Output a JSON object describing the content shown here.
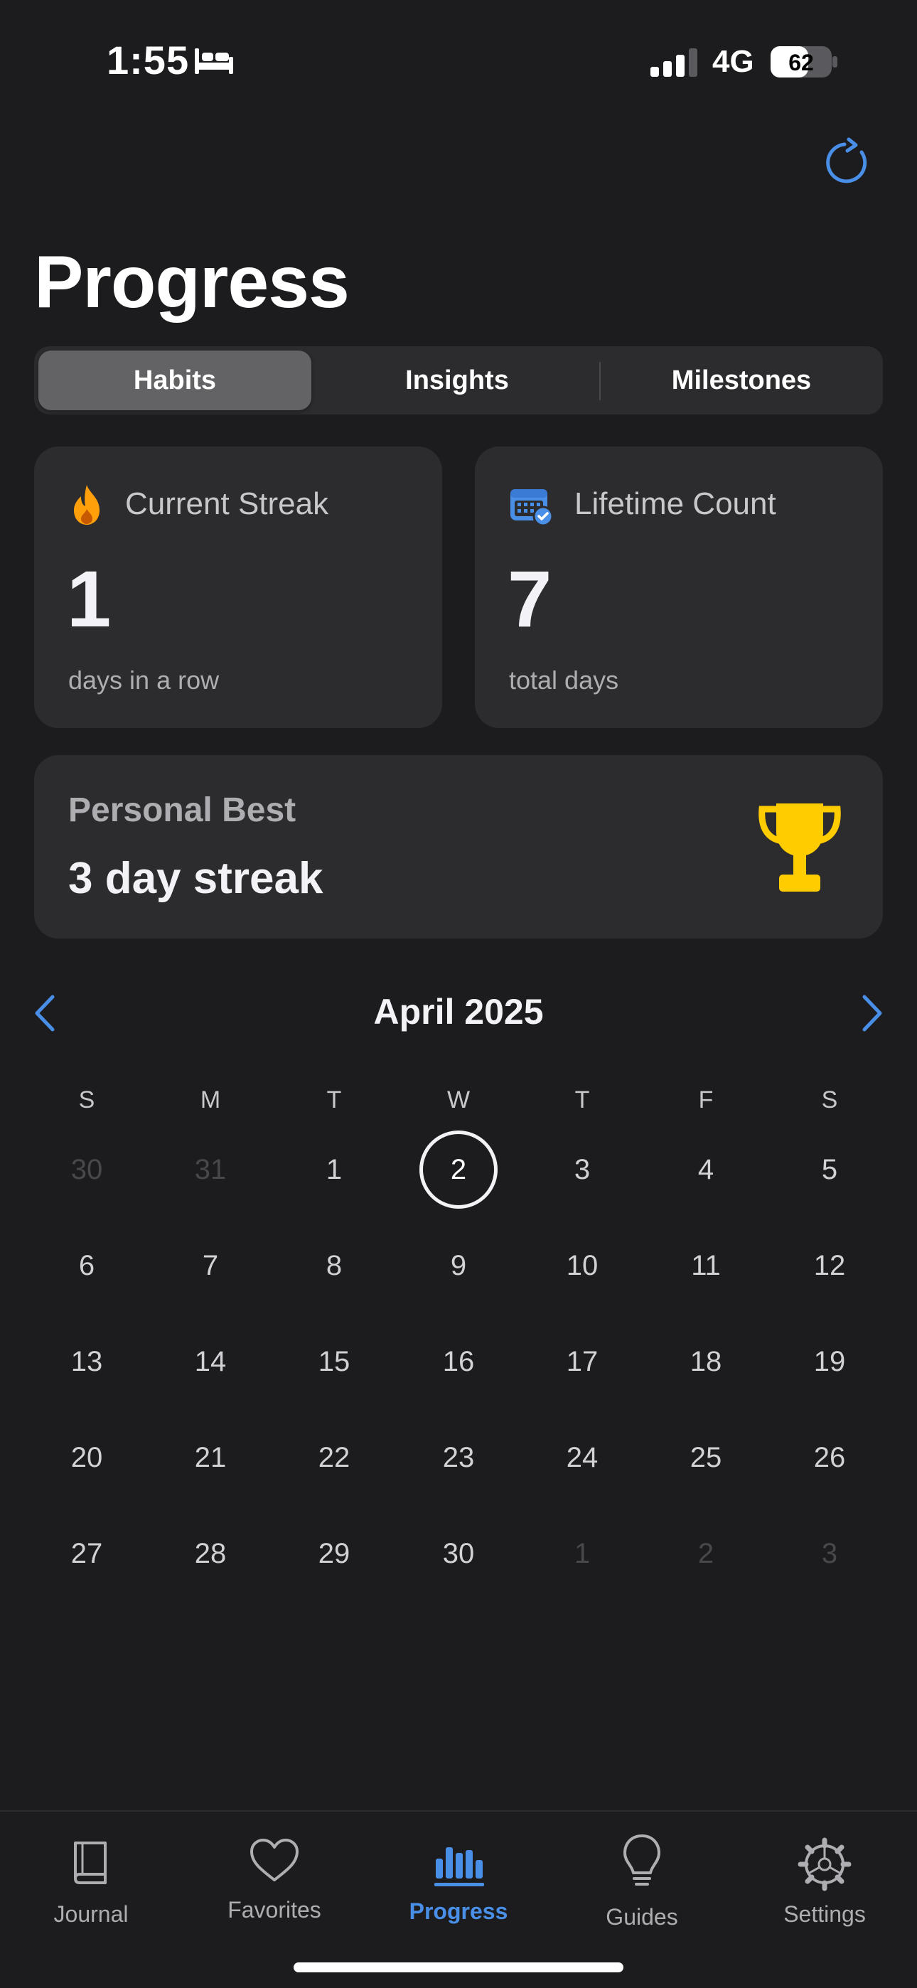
{
  "status_bar": {
    "time": "1:55",
    "network": "4G",
    "battery": "62",
    "battery_level": 0.62,
    "signal_bars": 3
  },
  "header": {
    "title": "Progress",
    "refresh_icon": "refresh-icon"
  },
  "segments": [
    {
      "label": "Habits",
      "selected": true
    },
    {
      "label": "Insights",
      "selected": false
    },
    {
      "label": "Milestones",
      "selected": false
    }
  ],
  "stats": {
    "current_streak": {
      "icon": "flame-icon",
      "label": "Current Streak",
      "value": "1",
      "sub": "days in a row"
    },
    "lifetime_count": {
      "icon": "calendar-check-icon",
      "label": "Lifetime Count",
      "value": "7",
      "sub": "total days"
    }
  },
  "personal_best": {
    "label": "Personal Best",
    "value": "3 day streak",
    "icon": "trophy-icon"
  },
  "calendar": {
    "month": "April 2025",
    "weekdays": [
      "S",
      "M",
      "T",
      "W",
      "T",
      "F",
      "S"
    ],
    "weeks": [
      [
        {
          "d": "30",
          "m": true
        },
        {
          "d": "31",
          "m": true
        },
        {
          "d": "1"
        },
        {
          "d": "2",
          "today": true
        },
        {
          "d": "3"
        },
        {
          "d": "4"
        },
        {
          "d": "5"
        }
      ],
      [
        {
          "d": "6"
        },
        {
          "d": "7"
        },
        {
          "d": "8"
        },
        {
          "d": "9"
        },
        {
          "d": "10"
        },
        {
          "d": "11"
        },
        {
          "d": "12"
        }
      ],
      [
        {
          "d": "13"
        },
        {
          "d": "14"
        },
        {
          "d": "15"
        },
        {
          "d": "16"
        },
        {
          "d": "17"
        },
        {
          "d": "18"
        },
        {
          "d": "19"
        }
      ],
      [
        {
          "d": "20"
        },
        {
          "d": "21"
        },
        {
          "d": "22"
        },
        {
          "d": "23"
        },
        {
          "d": "24"
        },
        {
          "d": "25"
        },
        {
          "d": "26"
        }
      ],
      [
        {
          "d": "27"
        },
        {
          "d": "28"
        },
        {
          "d": "29"
        },
        {
          "d": "30"
        },
        {
          "d": "1",
          "m": true
        },
        {
          "d": "2",
          "m": true
        },
        {
          "d": "3",
          "m": true
        }
      ]
    ]
  },
  "tab_bar": {
    "tabs": [
      {
        "label": "Journal",
        "icon": "book-icon",
        "active": false
      },
      {
        "label": "Favorites",
        "icon": "heart-icon",
        "active": false
      },
      {
        "label": "Progress",
        "icon": "bar-chart-icon",
        "active": true
      },
      {
        "label": "Guides",
        "icon": "lightbulb-icon",
        "active": false
      },
      {
        "label": "Settings",
        "icon": "gear-icon",
        "active": false
      }
    ]
  },
  "colors": {
    "accent": "#4a8fe7",
    "background": "#1c1c1e",
    "card": "#2c2c2e",
    "flame": "#ff9f0a",
    "trophy": "#ffcc00"
  }
}
